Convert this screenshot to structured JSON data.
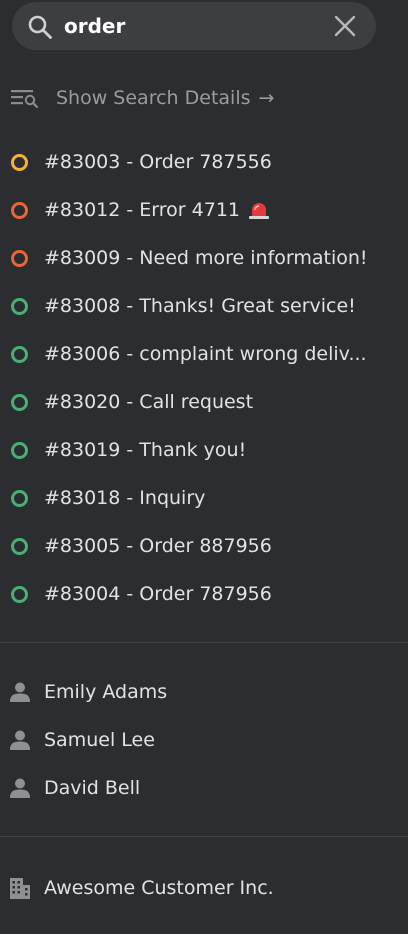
{
  "search": {
    "value": "order",
    "icon": "search-icon",
    "clear_icon": "close-icon"
  },
  "details_link": {
    "label": "Show Search Details",
    "arrow": "→",
    "icon": "search-details-icon"
  },
  "status_colors": {
    "new": "#f2b23a",
    "escalated": "#e8663a",
    "open": "#4caf72"
  },
  "tickets": [
    {
      "label": "#83003 - Order 787556",
      "status": "new"
    },
    {
      "label": "#83012 - Error 4711",
      "status": "escalated",
      "icon": "siren-icon"
    },
    {
      "label": "#83009 - Need more information!",
      "status": "escalated"
    },
    {
      "label": "#83008 - Thanks! Great service!",
      "status": "open"
    },
    {
      "label": "#83006 - complaint wrong deliv...",
      "status": "open"
    },
    {
      "label": "#83020 - Call request",
      "status": "open"
    },
    {
      "label": "#83019 - Thank you!",
      "status": "open"
    },
    {
      "label": "#83018 - Inquiry",
      "status": "open"
    },
    {
      "label": "#83005 - Order 887956",
      "status": "open"
    },
    {
      "label": "#83004 - Order 787956",
      "status": "open"
    }
  ],
  "users": [
    {
      "name": "Emily Adams",
      "icon": "person-icon"
    },
    {
      "name": "Samuel Lee",
      "icon": "person-icon"
    },
    {
      "name": "David Bell",
      "icon": "person-icon"
    }
  ],
  "organizations": [
    {
      "name": "Awesome Customer Inc.",
      "icon": "building-icon"
    }
  ]
}
